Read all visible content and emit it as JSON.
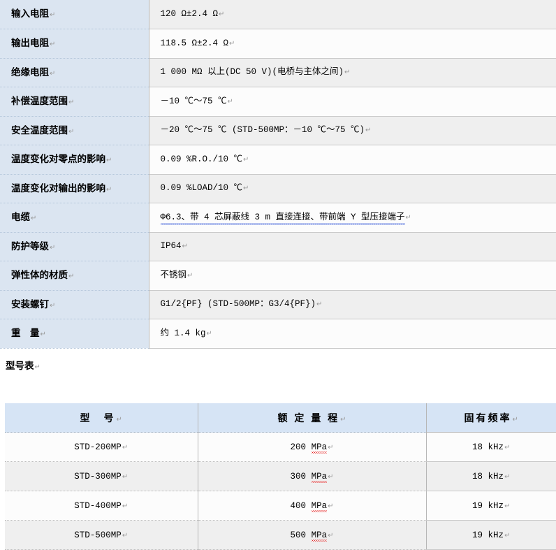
{
  "spec_table": {
    "rows": [
      {
        "label": "输入电阻",
        "value": "120 Ω±2.4 Ω"
      },
      {
        "label": "输出电阻",
        "value": "118.5 Ω±2.4 Ω"
      },
      {
        "label": "绝缘电阻",
        "value": "1 000 MΩ 以上(DC 50 V)(电桥与主体之间)"
      },
      {
        "label": "补偿温度范围",
        "value": "－10 ℃～75 ℃"
      },
      {
        "label": "安全温度范围",
        "value": "－20 ℃～75 ℃ (STD-500MP：－10 ℃～75 ℃)"
      },
      {
        "label": "温度变化对零点的影响",
        "value": "0.09 %R.O./10 ℃"
      },
      {
        "label": "温度变化对输出的影响",
        "value": "0.09 %LOAD/10 ℃"
      },
      {
        "label": "电缆",
        "value": "Φ6.3、带 4 芯屏蔽线 3 m 直接连接、带前端 Y 型压接端子"
      },
      {
        "label": "防护等级",
        "value": "IP64"
      },
      {
        "label": "弹性体的材质",
        "value": "不锈钢"
      },
      {
        "label": "安装螺钉",
        "value": "G1/2{PF} (STD-500MP：G3/4{PF})"
      },
      {
        "label": "重　量",
        "value": "约 1.4 kg"
      }
    ]
  },
  "section_caption": "型号表",
  "model_table": {
    "headers": [
      "型　号",
      "额 定 量 程",
      "固有频率"
    ],
    "rows": [
      {
        "model": "STD-200MP",
        "range_value": "200",
        "range_unit": "MPa",
        "frequency": "18 kHz"
      },
      {
        "model": "STD-300MP",
        "range_value": "300",
        "range_unit": "MPa",
        "frequency": "18 kHz"
      },
      {
        "model": "STD-400MP",
        "range_value": "400",
        "range_unit": "MPa",
        "frequency": "19 kHz"
      },
      {
        "model": "STD-500MP",
        "range_value": "500",
        "range_unit": "MPa",
        "frequency": "19 kHz"
      }
    ]
  },
  "marks": {
    "pilcrow": "↵"
  },
  "colors": {
    "label_background": "#dbe5f1",
    "header_background": "#d6e4f5",
    "row_shaded": "#efefef",
    "row_plain": "#fcfcfc",
    "border_gray": "#b6b6b6",
    "spellcheck_red": "#e81d1d"
  }
}
